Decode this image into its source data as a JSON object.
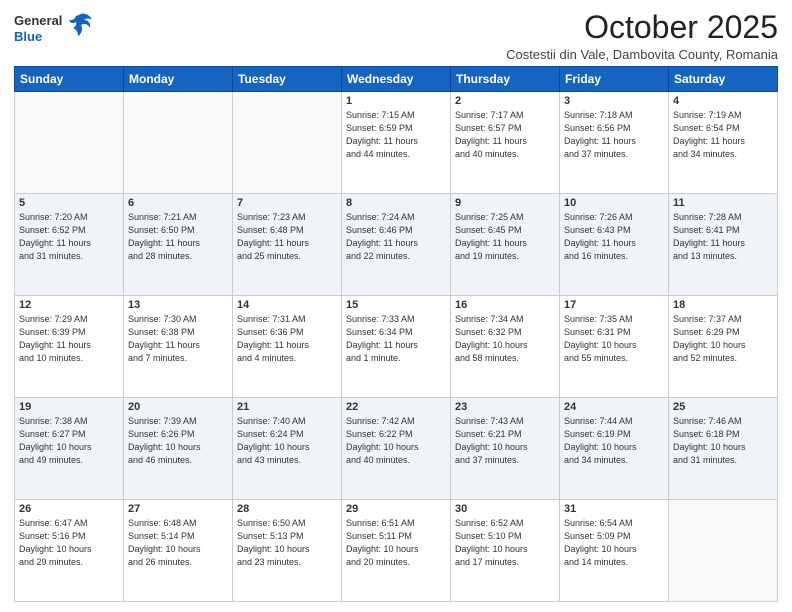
{
  "header": {
    "logo": {
      "general": "General",
      "blue": "Blue"
    },
    "title": "October 2025",
    "location": "Costestii din Vale, Dambovita County, Romania"
  },
  "days_of_week": [
    "Sunday",
    "Monday",
    "Tuesday",
    "Wednesday",
    "Thursday",
    "Friday",
    "Saturday"
  ],
  "weeks": [
    [
      {
        "day": "",
        "info": ""
      },
      {
        "day": "",
        "info": ""
      },
      {
        "day": "",
        "info": ""
      },
      {
        "day": "1",
        "info": "Sunrise: 7:15 AM\nSunset: 6:59 PM\nDaylight: 11 hours\nand 44 minutes."
      },
      {
        "day": "2",
        "info": "Sunrise: 7:17 AM\nSunset: 6:57 PM\nDaylight: 11 hours\nand 40 minutes."
      },
      {
        "day": "3",
        "info": "Sunrise: 7:18 AM\nSunset: 6:56 PM\nDaylight: 11 hours\nand 37 minutes."
      },
      {
        "day": "4",
        "info": "Sunrise: 7:19 AM\nSunset: 6:54 PM\nDaylight: 11 hours\nand 34 minutes."
      }
    ],
    [
      {
        "day": "5",
        "info": "Sunrise: 7:20 AM\nSunset: 6:52 PM\nDaylight: 11 hours\nand 31 minutes."
      },
      {
        "day": "6",
        "info": "Sunrise: 7:21 AM\nSunset: 6:50 PM\nDaylight: 11 hours\nand 28 minutes."
      },
      {
        "day": "7",
        "info": "Sunrise: 7:23 AM\nSunset: 6:48 PM\nDaylight: 11 hours\nand 25 minutes."
      },
      {
        "day": "8",
        "info": "Sunrise: 7:24 AM\nSunset: 6:46 PM\nDaylight: 11 hours\nand 22 minutes."
      },
      {
        "day": "9",
        "info": "Sunrise: 7:25 AM\nSunset: 6:45 PM\nDaylight: 11 hours\nand 19 minutes."
      },
      {
        "day": "10",
        "info": "Sunrise: 7:26 AM\nSunset: 6:43 PM\nDaylight: 11 hours\nand 16 minutes."
      },
      {
        "day": "11",
        "info": "Sunrise: 7:28 AM\nSunset: 6:41 PM\nDaylight: 11 hours\nand 13 minutes."
      }
    ],
    [
      {
        "day": "12",
        "info": "Sunrise: 7:29 AM\nSunset: 6:39 PM\nDaylight: 11 hours\nand 10 minutes."
      },
      {
        "day": "13",
        "info": "Sunrise: 7:30 AM\nSunset: 6:38 PM\nDaylight: 11 hours\nand 7 minutes."
      },
      {
        "day": "14",
        "info": "Sunrise: 7:31 AM\nSunset: 6:36 PM\nDaylight: 11 hours\nand 4 minutes."
      },
      {
        "day": "15",
        "info": "Sunrise: 7:33 AM\nSunset: 6:34 PM\nDaylight: 11 hours\nand 1 minute."
      },
      {
        "day": "16",
        "info": "Sunrise: 7:34 AM\nSunset: 6:32 PM\nDaylight: 10 hours\nand 58 minutes."
      },
      {
        "day": "17",
        "info": "Sunrise: 7:35 AM\nSunset: 6:31 PM\nDaylight: 10 hours\nand 55 minutes."
      },
      {
        "day": "18",
        "info": "Sunrise: 7:37 AM\nSunset: 6:29 PM\nDaylight: 10 hours\nand 52 minutes."
      }
    ],
    [
      {
        "day": "19",
        "info": "Sunrise: 7:38 AM\nSunset: 6:27 PM\nDaylight: 10 hours\nand 49 minutes."
      },
      {
        "day": "20",
        "info": "Sunrise: 7:39 AM\nSunset: 6:26 PM\nDaylight: 10 hours\nand 46 minutes."
      },
      {
        "day": "21",
        "info": "Sunrise: 7:40 AM\nSunset: 6:24 PM\nDaylight: 10 hours\nand 43 minutes."
      },
      {
        "day": "22",
        "info": "Sunrise: 7:42 AM\nSunset: 6:22 PM\nDaylight: 10 hours\nand 40 minutes."
      },
      {
        "day": "23",
        "info": "Sunrise: 7:43 AM\nSunset: 6:21 PM\nDaylight: 10 hours\nand 37 minutes."
      },
      {
        "day": "24",
        "info": "Sunrise: 7:44 AM\nSunset: 6:19 PM\nDaylight: 10 hours\nand 34 minutes."
      },
      {
        "day": "25",
        "info": "Sunrise: 7:46 AM\nSunset: 6:18 PM\nDaylight: 10 hours\nand 31 minutes."
      }
    ],
    [
      {
        "day": "26",
        "info": "Sunrise: 6:47 AM\nSunset: 5:16 PM\nDaylight: 10 hours\nand 29 minutes."
      },
      {
        "day": "27",
        "info": "Sunrise: 6:48 AM\nSunset: 5:14 PM\nDaylight: 10 hours\nand 26 minutes."
      },
      {
        "day": "28",
        "info": "Sunrise: 6:50 AM\nSunset: 5:13 PM\nDaylight: 10 hours\nand 23 minutes."
      },
      {
        "day": "29",
        "info": "Sunrise: 6:51 AM\nSunset: 5:11 PM\nDaylight: 10 hours\nand 20 minutes."
      },
      {
        "day": "30",
        "info": "Sunrise: 6:52 AM\nSunset: 5:10 PM\nDaylight: 10 hours\nand 17 minutes."
      },
      {
        "day": "31",
        "info": "Sunrise: 6:54 AM\nSunset: 5:09 PM\nDaylight: 10 hours\nand 14 minutes."
      },
      {
        "day": "",
        "info": ""
      }
    ]
  ]
}
